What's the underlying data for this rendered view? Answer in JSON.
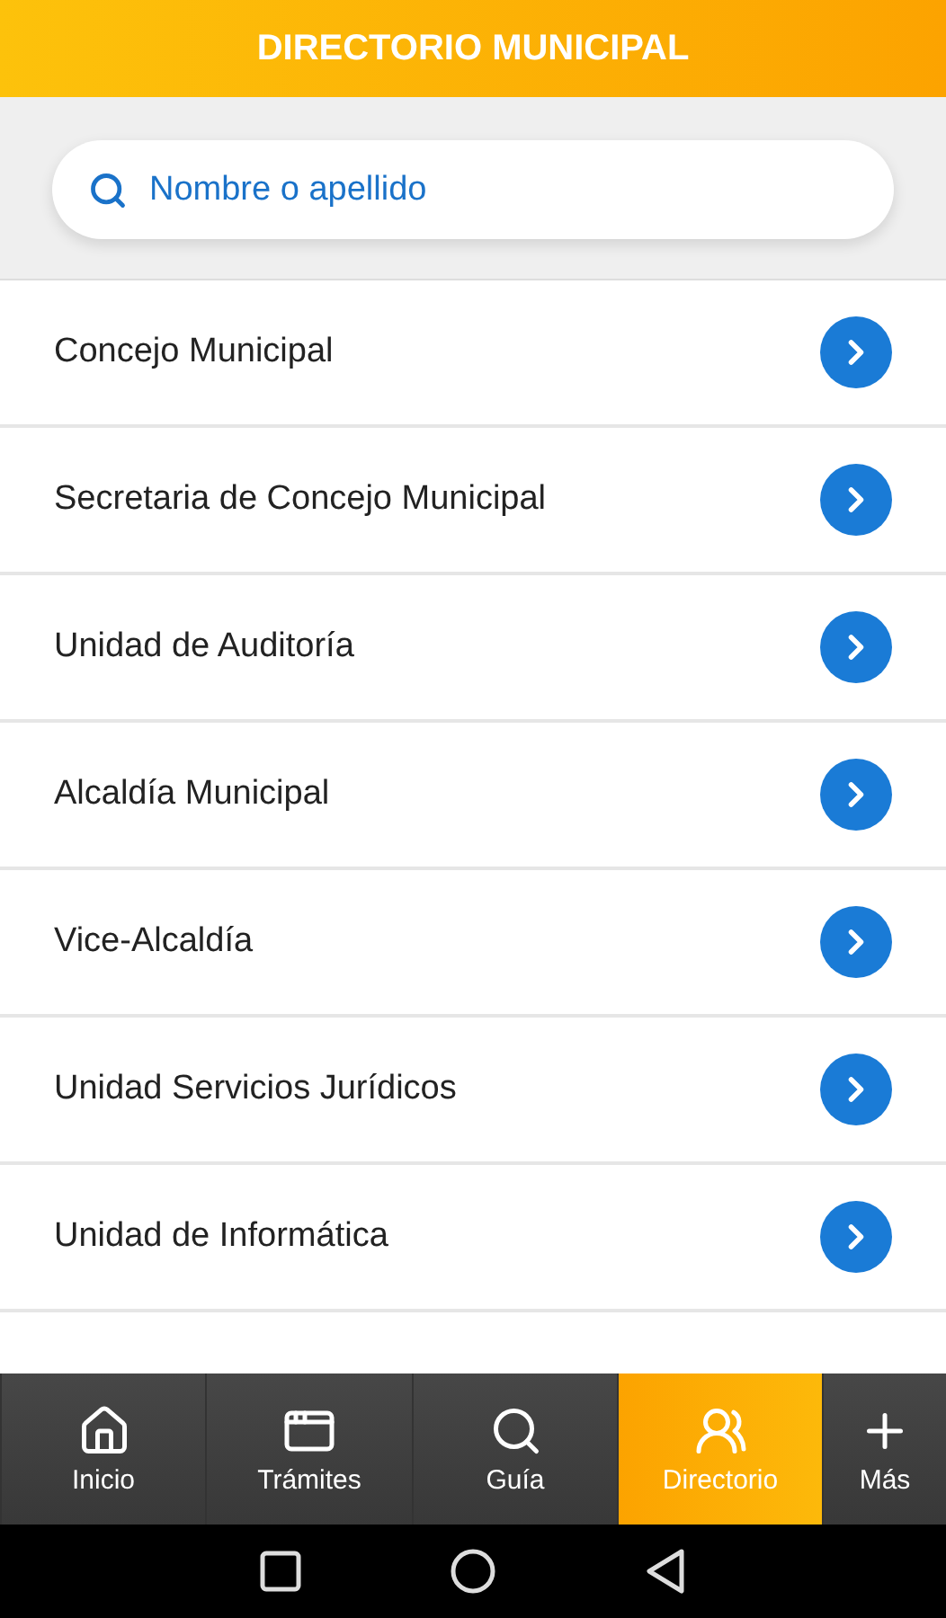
{
  "header": {
    "title": "DIRECTORIO MUNICIPAL"
  },
  "search": {
    "placeholder": "Nombre o apellido"
  },
  "items": [
    {
      "label": "Concejo Municipal"
    },
    {
      "label": "Secretaria de Concejo Municipal"
    },
    {
      "label": "Unidad de Auditoría"
    },
    {
      "label": "Alcaldía Municipal"
    },
    {
      "label": "Vice-Alcaldía"
    },
    {
      "label": "Unidad Servicios Jurídicos"
    },
    {
      "label": "Unidad de Informática"
    }
  ],
  "nav": [
    {
      "label": "Inicio",
      "selected": false
    },
    {
      "label": "Trámites",
      "selected": false
    },
    {
      "label": "Guía",
      "selected": false
    },
    {
      "label": "Directorio",
      "selected": true
    },
    {
      "label": "Más",
      "selected": false
    }
  ]
}
